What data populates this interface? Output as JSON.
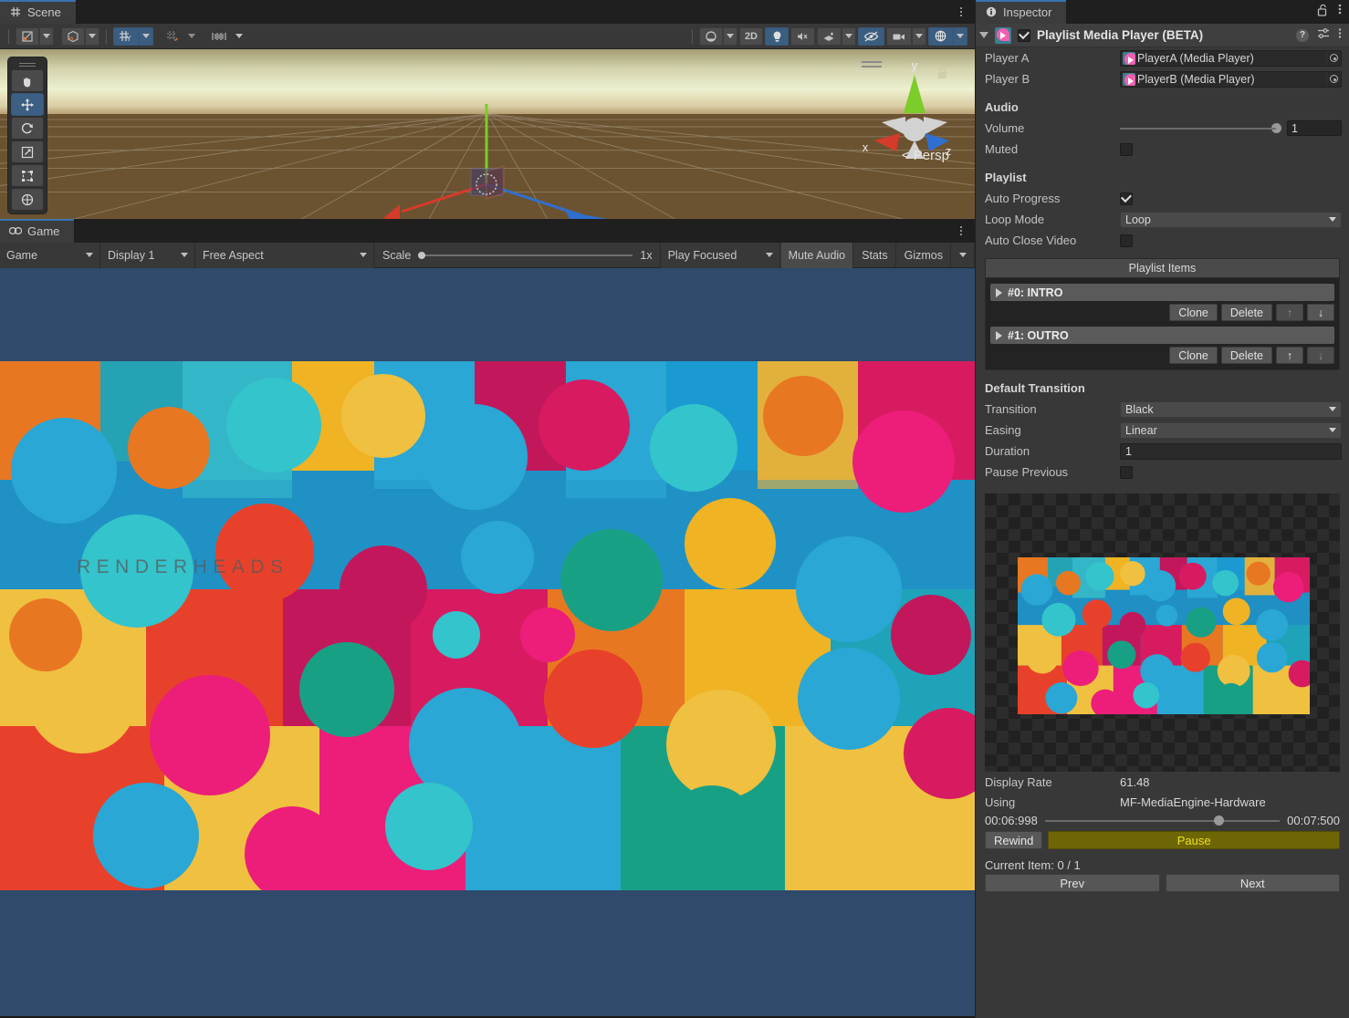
{
  "scene_panel": {
    "tab_label": "Scene",
    "tab_icon": "grid-icon",
    "toolbar": {
      "draw_mode_icon": "shaded-mode-icon",
      "draw_mode_caret": "chevron-down-icon",
      "twod_mode_icon": "wireframe-cube-icon",
      "twod_caret": "chevron-down-icon",
      "grid_visibility_icon": "grid-axis-y-icon",
      "grid_caret": "chevron-down-icon",
      "snap_increment_icon": "grid-snap-icon",
      "snap_caret": "chevron-down-icon",
      "component_tools_icon": "component-tools-icon",
      "component_caret": "chevron-down-icon",
      "right_items": [
        {
          "icon": "shading-sphere-icon",
          "label": "",
          "active": false,
          "caret": true
        },
        {
          "icon": "",
          "label": "2D",
          "active": false,
          "caret": false
        },
        {
          "icon": "light-bulb-icon",
          "label": "",
          "active": true,
          "caret": false
        },
        {
          "icon": "audio-mute-icon",
          "label": "",
          "active": false,
          "caret": false
        },
        {
          "icon": "fx-effects-icon",
          "label": "",
          "active": false,
          "caret": true
        },
        {
          "icon": "scene-visibility-off-icon",
          "label": "",
          "active": true,
          "caret": false
        },
        {
          "icon": "camera-icon",
          "label": "",
          "active": false,
          "caret": true
        },
        {
          "icon": "gizmos-globe-icon",
          "label": "",
          "active": true,
          "caret": true
        }
      ]
    },
    "tools": [
      {
        "name": "hand-tool",
        "icon": "hand-icon",
        "selected": false
      },
      {
        "name": "move-tool",
        "icon": "move-arrows-icon",
        "selected": true
      },
      {
        "name": "rotate-tool",
        "icon": "rotate-icon",
        "selected": false
      },
      {
        "name": "scale-tool",
        "icon": "scale-icon",
        "selected": false
      },
      {
        "name": "rect-tool",
        "icon": "rect-transform-icon",
        "selected": false
      },
      {
        "name": "transform-tool",
        "icon": "transform-combined-icon",
        "selected": false
      }
    ],
    "gizmo": {
      "axis_x": "x",
      "axis_y": "y",
      "axis_z": "z",
      "perspective_label": "< Persp",
      "color_x": "#d43b2a",
      "color_y": "#7ccc2a",
      "color_z": "#2f6fd0"
    },
    "kebab_icon": "more-options-icon"
  },
  "game_panel": {
    "tab_label": "Game",
    "tab_icon": "gamepad-icon",
    "toolbar": {
      "view_selector": "Game",
      "display_selector": "Display 1",
      "aspect_selector": "Free Aspect",
      "scale_label": "Scale",
      "scale_value": "1x",
      "play_mode_selector": "Play Focused",
      "mute_audio": "Mute Audio",
      "stats": "Stats",
      "gizmos": "Gizmos",
      "gizmos_caret": "chevron-down-icon"
    },
    "letterbox_color": "#2f4a6b",
    "watermark": "RENDERHEADS",
    "kebab_icon": "more-options-icon"
  },
  "inspector": {
    "tab_label": "Inspector",
    "tab_icon": "info-circle-icon",
    "lock_icon": "lock-open-icon",
    "kebab_icon": "more-options-icon",
    "component": {
      "title": "Playlist Media Player (BETA)",
      "icon": "media-player-icon",
      "enabled": true,
      "foldout_open": true,
      "help_icon": "help-icon",
      "preset_icon": "preset-sliders-icon",
      "menu_icon": "more-options-icon"
    },
    "players": [
      {
        "label": "Player A",
        "value": "PlayerA (Media Player)",
        "picker_icon": "object-picker-icon"
      },
      {
        "label": "Player B",
        "value": "PlayerB (Media Player)",
        "picker_icon": "object-picker-icon"
      }
    ],
    "audio": {
      "section": "Audio",
      "volume_label": "Volume",
      "volume_value": "1",
      "volume_fraction": 1.0,
      "muted_label": "Muted",
      "muted_checked": false
    },
    "playlist": {
      "section": "Playlist",
      "auto_progress_label": "Auto Progress",
      "auto_progress_checked": true,
      "loop_mode_label": "Loop Mode",
      "loop_mode_value": "Loop",
      "auto_close_label": "Auto Close Video",
      "auto_close_checked": false,
      "items_header": "Playlist Items",
      "items": [
        {
          "title": "#0: INTRO",
          "foldout_icon": "triangle-right-icon",
          "clone": "Clone",
          "delete": "Delete",
          "move_up_icon": "arrow-up-icon",
          "move_down_icon": "arrow-down-icon",
          "up_enabled": false,
          "down_enabled": true
        },
        {
          "title": "#1: OUTRO",
          "foldout_icon": "triangle-right-icon",
          "clone": "Clone",
          "delete": "Delete",
          "move_up_icon": "arrow-up-icon",
          "move_down_icon": "arrow-down-icon",
          "up_enabled": true,
          "down_enabled": false
        }
      ]
    },
    "default_transition": {
      "section": "Default Transition",
      "transition_label": "Transition",
      "transition_value": "Black",
      "easing_label": "Easing",
      "easing_value": "Linear",
      "duration_label": "Duration",
      "duration_value": "1",
      "pause_previous_label": "Pause Previous",
      "pause_previous_checked": false
    },
    "playback": {
      "display_rate_label": "Display Rate",
      "display_rate_value": "61.48",
      "using_label": "Using",
      "using_value": "MF-MediaEngine-Hardware",
      "current_time": "00:06:998",
      "total_time": "00:07:500",
      "progress_fraction": 0.72,
      "rewind_label": "Rewind",
      "pause_label": "Pause",
      "pause_color": "#6e6505",
      "pause_text_color": "#e8e020",
      "current_item_label": "Current Item: 0 / 1",
      "prev_label": "Prev",
      "next_label": "Next"
    }
  }
}
